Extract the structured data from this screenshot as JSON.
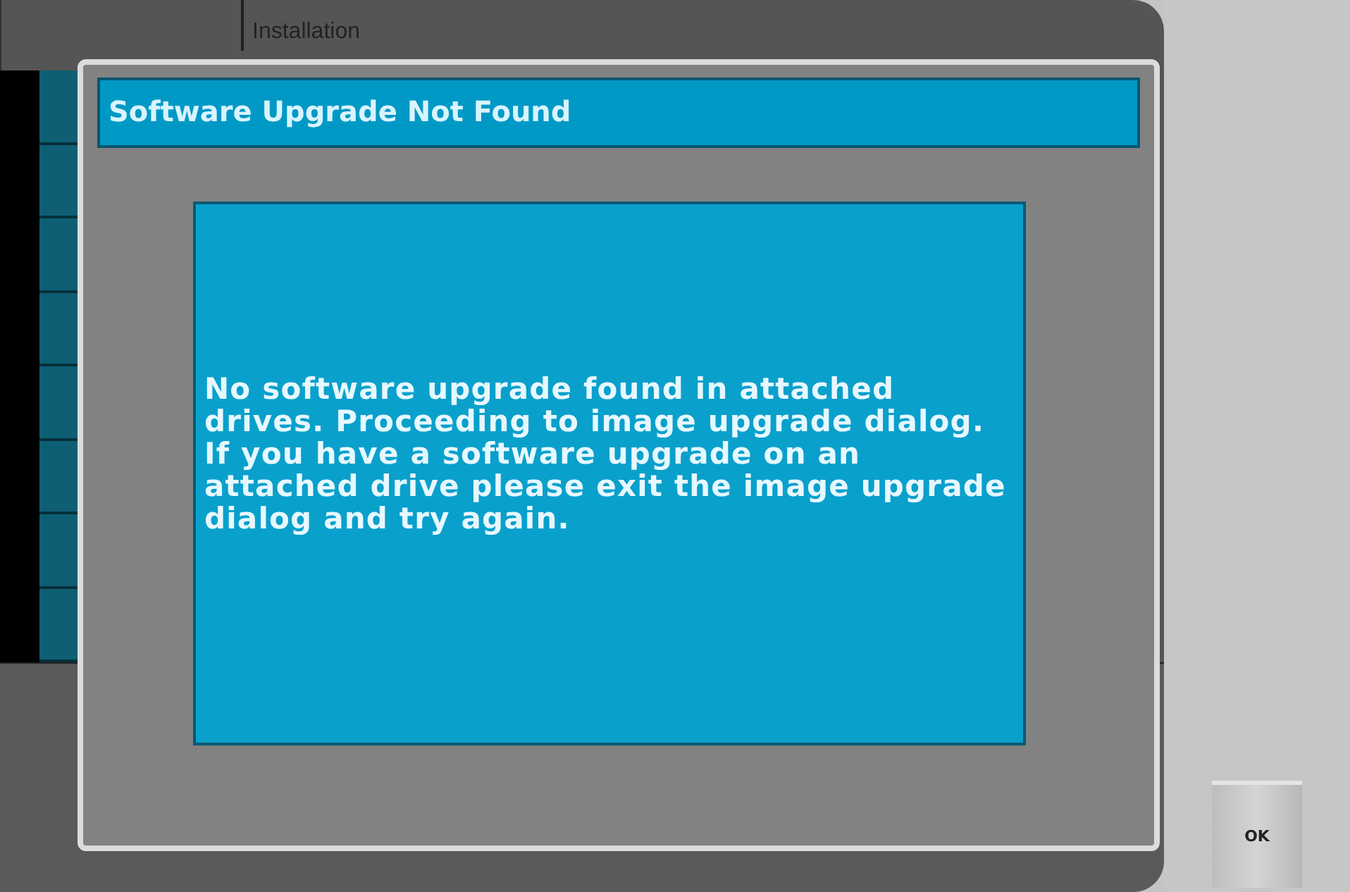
{
  "background": {
    "header": "Installation"
  },
  "dialog": {
    "title": "Software Upgrade Not Found",
    "message": "No software upgrade found in attached drives. Proceeding to image upgrade dialog. If you have a software upgrade on an attached drive please exit the image upgrade dialog and try again."
  },
  "buttons": [
    {
      "label": "OK"
    }
  ]
}
